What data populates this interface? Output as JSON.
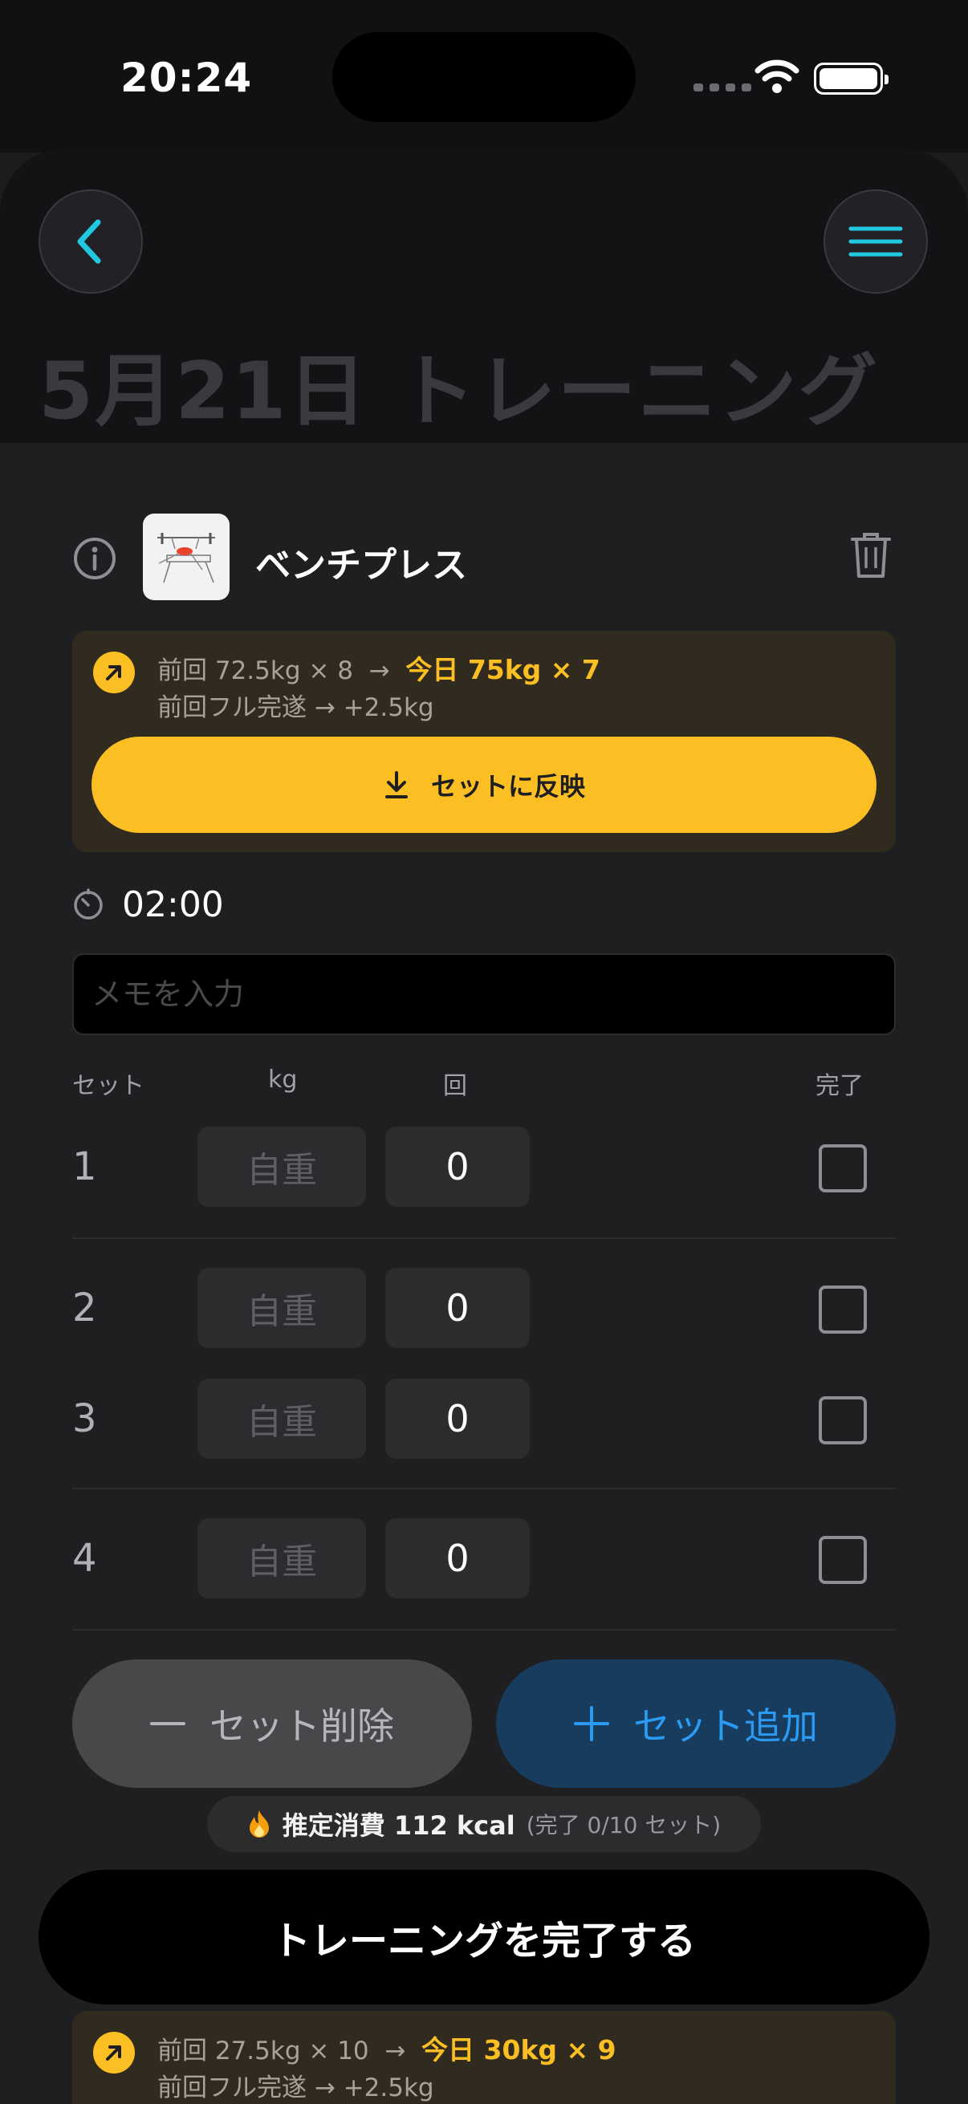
{
  "status_bar": {
    "time": "20:24"
  },
  "header": {
    "title": "5月21日 トレーニング",
    "back_icon": "chevron-left-icon",
    "menu_icon": "hamburger-menu-icon"
  },
  "exercise": {
    "name": "ベンチプレス",
    "suggestion": {
      "previous": "前回 72.5kg × 8",
      "today": "今日 75kg × 7",
      "note": "前回フル完遂 → +2.5kg",
      "apply_label": "セットに反映"
    },
    "rest_timer": "02:00",
    "memo_placeholder": "メモを入力",
    "columns": {
      "set": "セット",
      "kg": "kg",
      "reps": "回",
      "done": "完了"
    },
    "sets": [
      {
        "number": "1",
        "weight": "自重",
        "reps": "0",
        "done": false
      },
      {
        "number": "2",
        "weight": "自重",
        "reps": "0",
        "done": false
      },
      {
        "number": "3",
        "weight": "自重",
        "reps": "0",
        "done": false
      },
      {
        "number": "4",
        "weight": "自重",
        "reps": "0",
        "done": false
      }
    ],
    "delete_set_label": "セット削除",
    "add_set_label": "セット追加"
  },
  "calories": {
    "label": "推定消費 112 kcal",
    "progress": "(完了 0/10 セット)"
  },
  "finish_label": "トレーニングを完了する",
  "next_exercise_suggestion": {
    "previous": "前回 27.5kg × 10",
    "today": "今日 30kg × 9",
    "note": "前回フル完遂 → +2.5kg"
  },
  "colors": {
    "accent_yellow": "#fbbf24",
    "accent_blue": "#2a9af3",
    "accent_cyan": "#22c8e0",
    "background": "#1c1c1e"
  }
}
